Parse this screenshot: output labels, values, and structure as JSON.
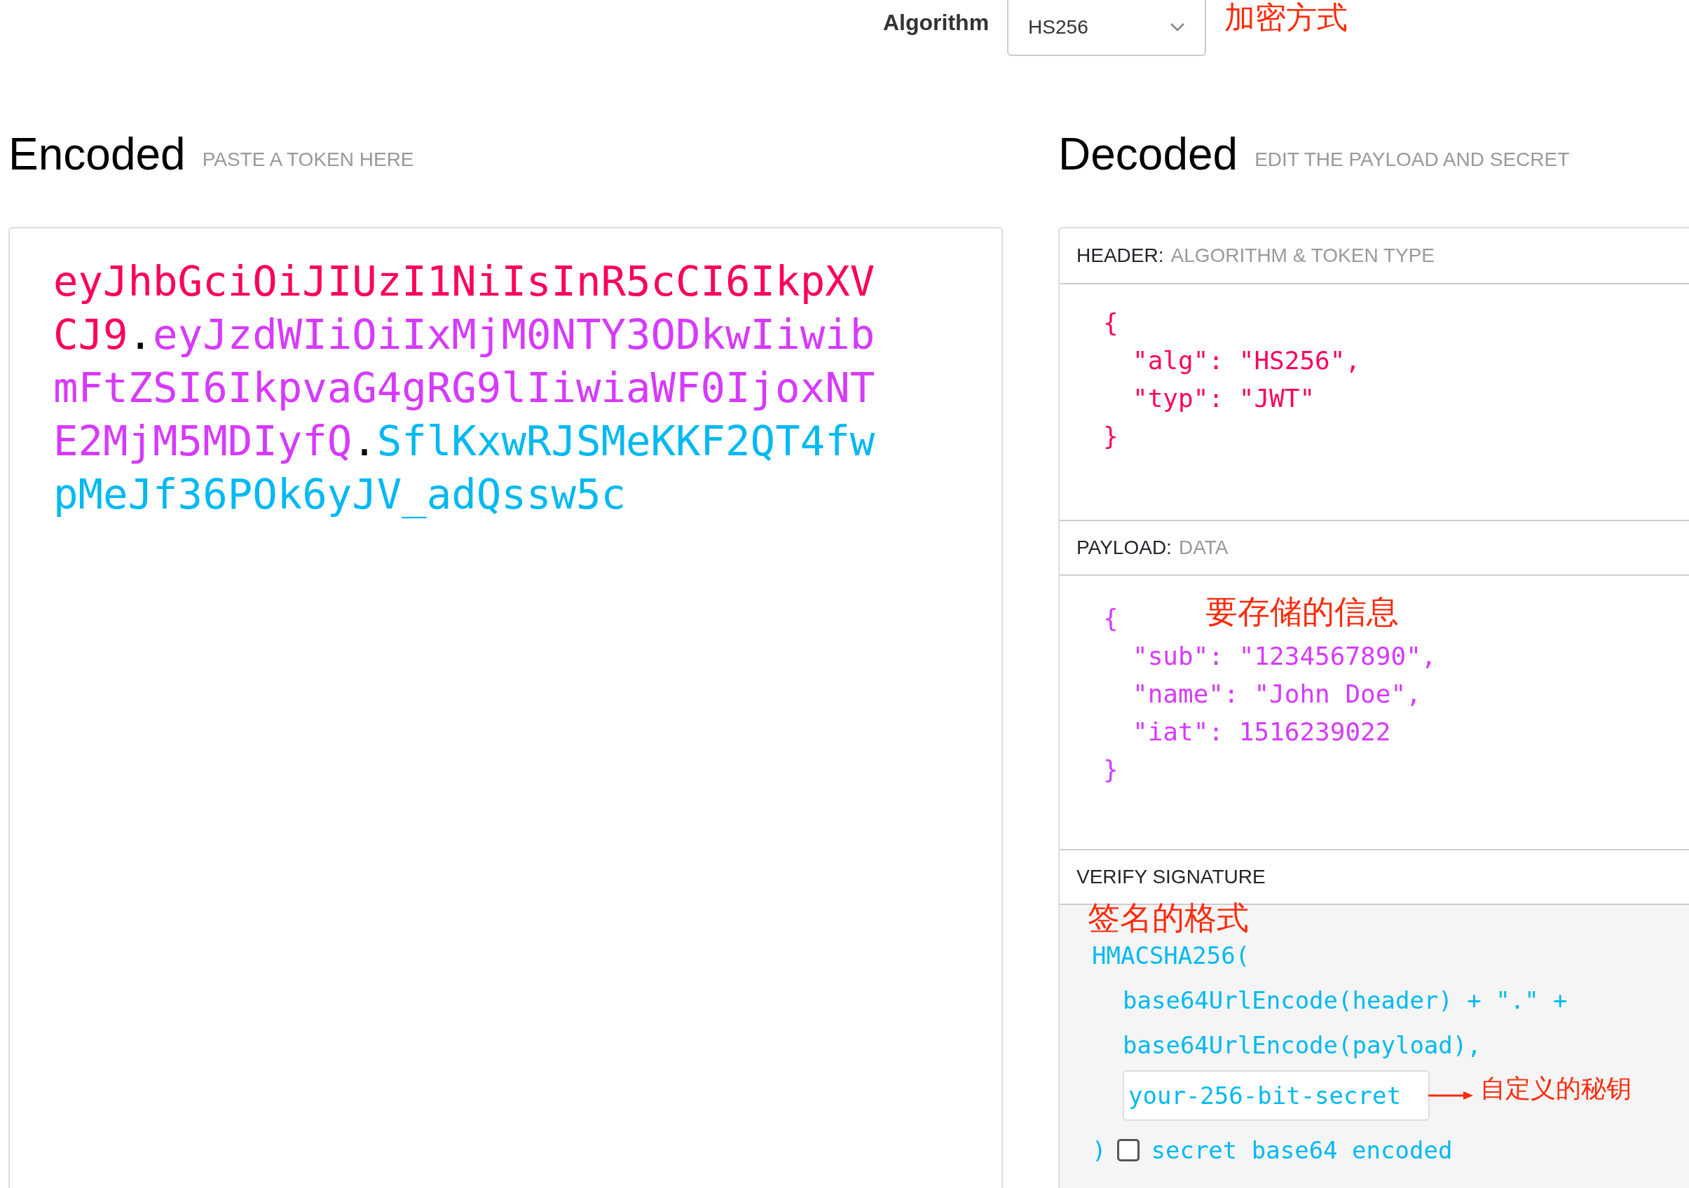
{
  "algorithm": {
    "label": "Algorithm",
    "value": "HS256",
    "annotation": "加密方式"
  },
  "encoded": {
    "title": "Encoded",
    "subtitle": "PASTE A TOKEN HERE",
    "token_parts": [
      {
        "text": "eyJhbGciOiJIUzI1NiIsInR5cCI6IkpXVCJ9",
        "color": "#fb015b"
      },
      {
        "text": ".",
        "color": "#000000"
      },
      {
        "text": "eyJzdWIiOiIxMjM0NTY3ODkwIiwibmFtZSI6IkpvaG4gRG9lIiwiaWF0IjoxNTE2MjM5MDIyfQ",
        "color": "#d63aff"
      },
      {
        "text": ".",
        "color": "#000000"
      },
      {
        "text": "SflKxwRJSMeKKF2QT4fwpMeJf36POk6yJV_adQssw5c",
        "color": "#00b9f1"
      }
    ]
  },
  "decoded": {
    "title": "Decoded",
    "subtitle": "EDIT THE PAYLOAD AND SECRET",
    "header": {
      "label": "HEADER:",
      "sublabel": "ALGORITHM & TOKEN TYPE",
      "lines": [
        {
          "kind": "brace",
          "text": "{"
        },
        {
          "kind": "field",
          "text": "\"alg\": \"HS256\","
        },
        {
          "kind": "field",
          "text": "\"typ\": \"JWT\""
        },
        {
          "kind": "brace",
          "text": "}"
        }
      ]
    },
    "payload": {
      "label": "PAYLOAD:",
      "sublabel": "DATA",
      "annotation": "要存储的信息",
      "lines": [
        {
          "kind": "brace",
          "text": "{"
        },
        {
          "kind": "field",
          "text": "\"sub\": \"1234567890\","
        },
        {
          "kind": "field",
          "text": "\"name\": \"John Doe\","
        },
        {
          "kind": "field",
          "text": "\"iat\": 1516239022"
        },
        {
          "kind": "brace",
          "text": "}"
        }
      ]
    },
    "signature": {
      "label": "VERIFY SIGNATURE",
      "annotation": "签名的格式",
      "lines": [
        "HMACSHA256(",
        "base64UrlEncode(header) + \".\" +",
        "base64UrlEncode(payload),"
      ],
      "secret": {
        "value": "your-256-bit-secret",
        "annotation": "自定义的秘钥"
      },
      "closing": ")",
      "base64_checkbox": {
        "label": "secret base64 encoded",
        "checked": false
      }
    }
  }
}
